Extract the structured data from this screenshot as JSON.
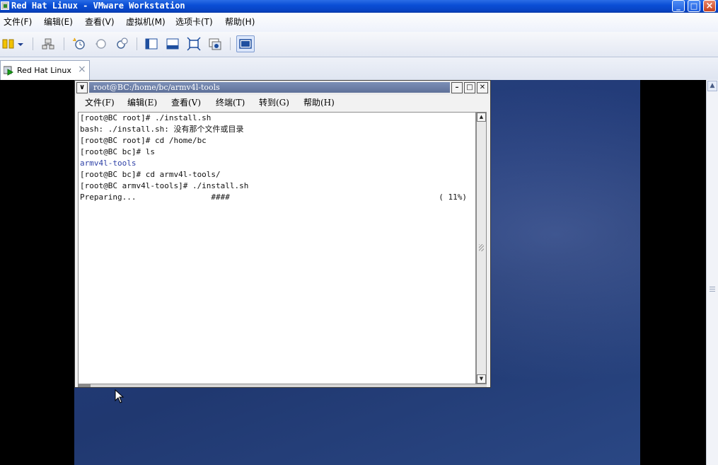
{
  "window": {
    "title": "Red Hat Linux - VMware Workstation",
    "controls": {
      "minimize": "_",
      "maximize": "□",
      "close": "×"
    }
  },
  "menu": {
    "items": [
      "文件(F)",
      "编辑(E)",
      "查看(V)",
      "虚拟机(M)",
      "选项卡(T)",
      "帮助(H)"
    ]
  },
  "toolbar": {
    "icons": [
      "power-icon",
      "dropdown-arrow-icon",
      "network-icon",
      "take-snapshot-icon",
      "revert-snapshot-icon",
      "snapshot-manager-icon",
      "show-sidebar-icon",
      "thumbnail-bar-icon",
      "full-screen-icon",
      "unity-icon",
      "console-view-icon"
    ]
  },
  "tabs": [
    {
      "label": "Red Hat Linux",
      "close": "×"
    }
  ],
  "guest": {
    "terminal": {
      "title": "root@BC:/home/bc/armv4l-tools",
      "menu": [
        "文件(F)",
        "编辑(E)",
        "查看(V)",
        "终端(T)",
        "转到(G)",
        "帮助(H)"
      ],
      "lines": [
        "[root@BC root]# ./install.sh",
        "bash: ./install.sh: 没有那个文件或目录",
        "[root@BC root]# cd /home/bc",
        "[root@BC bc]# ls",
        "armv4l-tools",
        "[root@BC bc]# cd armv4l-tools/",
        "[root@BC armv4l-tools]# ./install.sh",
        "Preparing...                ####"
      ],
      "progress": "( 11%)"
    }
  },
  "colors": {
    "title_bar": "#0a4ed6",
    "desktop": "#223b78",
    "directory_text": "#2c3fa6"
  }
}
